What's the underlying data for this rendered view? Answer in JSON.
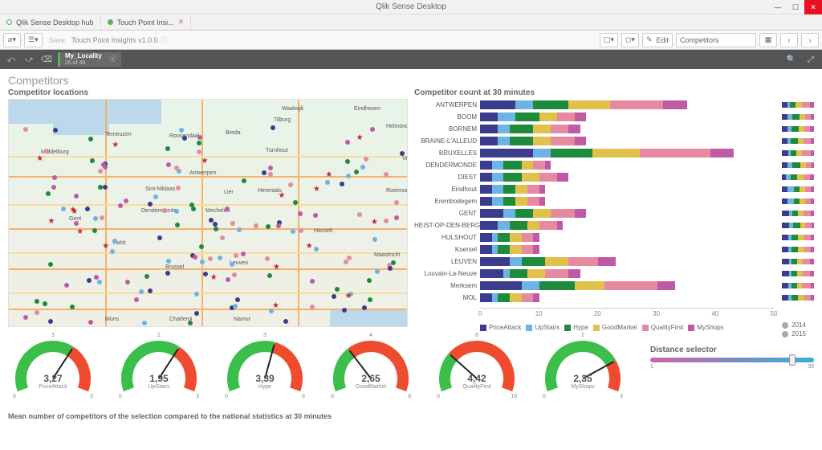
{
  "window": {
    "title": "Qlik Sense Desktop"
  },
  "tabs": [
    {
      "label": "Qlik Sense Desktop hub"
    },
    {
      "label": "Touch Point Insi..."
    }
  ],
  "toolbar": {
    "save": "Save",
    "breadcrumb": "Touch Point Insights v1.0.0",
    "edit": "Edit",
    "sheetname": "Competitors"
  },
  "selection": {
    "field": "My_Locality",
    "count": "26 of 49"
  },
  "sheet": {
    "title": "Competitors"
  },
  "map": {
    "title": "Competitor locations",
    "cities": [
      "Eindhoven",
      "Antwerpen",
      "Gent",
      "Brussel",
      "Leuven",
      "Maastricht",
      "Hasselt",
      "Mechelen",
      "Terneuzen",
      "Middelburg",
      "Tilburg",
      "Breda",
      "Roosendaal",
      "Waalwijk",
      "Helmond",
      "Venlo",
      "Roermond",
      "Mons",
      "Namur",
      "Charleroi",
      "Aalst",
      "Sint-Niklaas",
      "Dendermonde",
      "Turnhout",
      "Herentals",
      "Lier"
    ]
  },
  "chart_data": {
    "type": "bar",
    "title": "Competitor count at 30 minutes",
    "categories": [
      "ANTWERPEN",
      "BOOM",
      "BORNEM",
      "BRAINE-L'ALLEUD",
      "BRUXELLES",
      "DENDERMONDE",
      "DIEST",
      "Eindhout",
      "Erembodegem",
      "GENT",
      "HEIST-OP-DEN-BERG",
      "HULSHOUT",
      "Koersel",
      "LEUVEN",
      "Louvain-La-Neuve",
      "Merksem",
      "MOL"
    ],
    "series": [
      {
        "name": "PriceAttack",
        "color": "#3c3c8c",
        "values": [
          6,
          3,
          3,
          3,
          9,
          2,
          2,
          2,
          2,
          4,
          3,
          2,
          2,
          5,
          4,
          7,
          2
        ]
      },
      {
        "name": "UpStairs",
        "color": "#6db3e6",
        "values": [
          3,
          3,
          2,
          2,
          3,
          2,
          2,
          2,
          2,
          2,
          2,
          1,
          1,
          2,
          1,
          3,
          1
        ]
      },
      {
        "name": "Hype",
        "color": "#1e8a3b",
        "values": [
          6,
          4,
          4,
          4,
          7,
          3,
          3,
          2,
          2,
          3,
          3,
          2,
          2,
          4,
          3,
          6,
          2
        ]
      },
      {
        "name": "GoodMarket",
        "color": "#e0c24a",
        "values": [
          7,
          3,
          3,
          3,
          8,
          2,
          3,
          2,
          2,
          3,
          2,
          2,
          2,
          4,
          3,
          5,
          2
        ]
      },
      {
        "name": "QualityFirst",
        "color": "#e58aa0",
        "values": [
          9,
          3,
          3,
          4,
          12,
          2,
          3,
          2,
          2,
          4,
          3,
          2,
          2,
          5,
          4,
          9,
          2
        ]
      },
      {
        "name": "MyShops",
        "color": "#c05aa6",
        "values": [
          4,
          2,
          2,
          2,
          4,
          1,
          2,
          1,
          1,
          2,
          1,
          1,
          1,
          3,
          2,
          3,
          1
        ]
      }
    ],
    "xticks": [
      0,
      10,
      20,
      30,
      40,
      50
    ],
    "legend_years": [
      "2014",
      "2015"
    ]
  },
  "gauges": [
    {
      "name": "PriceAttack",
      "value": "3,27",
      "min": "0",
      "max": "5",
      "mark": "3",
      "frac": 0.65
    },
    {
      "name": "UpStairs",
      "value": "1,95",
      "min": "0",
      "max": "3",
      "mark": "2",
      "frac": 0.65
    },
    {
      "name": "Hype",
      "value": "3,39",
      "min": "0",
      "max": "6",
      "mark": "3",
      "frac": 0.57
    },
    {
      "name": "GoodMarket",
      "value": "2,65",
      "min": "0",
      "max": "8",
      "mark": "4",
      "frac": 0.33
    },
    {
      "name": "QualityFirst",
      "value": "4,42",
      "min": "0",
      "max": "16",
      "mark": "8",
      "frac": 0.28
    },
    {
      "name": "MyShops",
      "value": "2,35",
      "min": "0",
      "max": "3",
      "mark": "2",
      "frac": 0.78
    }
  ],
  "footnote": "Mean number of competitors of the selection compared to the national statistics at 30 minutes",
  "slider": {
    "title": "Distance selector",
    "min": "1",
    "max": "30",
    "pos": 0.85
  }
}
